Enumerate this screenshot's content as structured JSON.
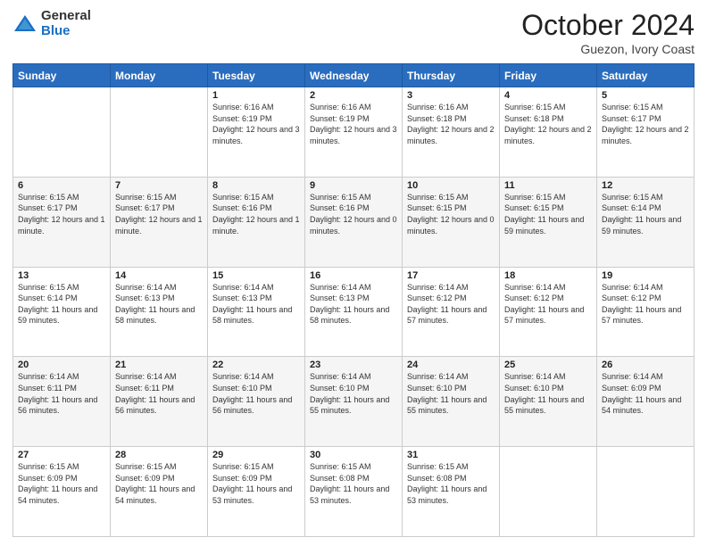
{
  "header": {
    "logo": {
      "general": "General",
      "blue": "Blue"
    },
    "title": "October 2024",
    "subtitle": "Guezon, Ivory Coast"
  },
  "weekdays": [
    "Sunday",
    "Monday",
    "Tuesday",
    "Wednesday",
    "Thursday",
    "Friday",
    "Saturday"
  ],
  "weeks": [
    [
      {
        "day": "",
        "info": ""
      },
      {
        "day": "",
        "info": ""
      },
      {
        "day": "1",
        "info": "Sunrise: 6:16 AM\nSunset: 6:19 PM\nDaylight: 12 hours and 3 minutes."
      },
      {
        "day": "2",
        "info": "Sunrise: 6:16 AM\nSunset: 6:19 PM\nDaylight: 12 hours and 3 minutes."
      },
      {
        "day": "3",
        "info": "Sunrise: 6:16 AM\nSunset: 6:18 PM\nDaylight: 12 hours and 2 minutes."
      },
      {
        "day": "4",
        "info": "Sunrise: 6:15 AM\nSunset: 6:18 PM\nDaylight: 12 hours and 2 minutes."
      },
      {
        "day": "5",
        "info": "Sunrise: 6:15 AM\nSunset: 6:17 PM\nDaylight: 12 hours and 2 minutes."
      }
    ],
    [
      {
        "day": "6",
        "info": "Sunrise: 6:15 AM\nSunset: 6:17 PM\nDaylight: 12 hours and 1 minute."
      },
      {
        "day": "7",
        "info": "Sunrise: 6:15 AM\nSunset: 6:17 PM\nDaylight: 12 hours and 1 minute."
      },
      {
        "day": "8",
        "info": "Sunrise: 6:15 AM\nSunset: 6:16 PM\nDaylight: 12 hours and 1 minute."
      },
      {
        "day": "9",
        "info": "Sunrise: 6:15 AM\nSunset: 6:16 PM\nDaylight: 12 hours and 0 minutes."
      },
      {
        "day": "10",
        "info": "Sunrise: 6:15 AM\nSunset: 6:15 PM\nDaylight: 12 hours and 0 minutes."
      },
      {
        "day": "11",
        "info": "Sunrise: 6:15 AM\nSunset: 6:15 PM\nDaylight: 11 hours and 59 minutes."
      },
      {
        "day": "12",
        "info": "Sunrise: 6:15 AM\nSunset: 6:14 PM\nDaylight: 11 hours and 59 minutes."
      }
    ],
    [
      {
        "day": "13",
        "info": "Sunrise: 6:15 AM\nSunset: 6:14 PM\nDaylight: 11 hours and 59 minutes."
      },
      {
        "day": "14",
        "info": "Sunrise: 6:14 AM\nSunset: 6:13 PM\nDaylight: 11 hours and 58 minutes."
      },
      {
        "day": "15",
        "info": "Sunrise: 6:14 AM\nSunset: 6:13 PM\nDaylight: 11 hours and 58 minutes."
      },
      {
        "day": "16",
        "info": "Sunrise: 6:14 AM\nSunset: 6:13 PM\nDaylight: 11 hours and 58 minutes."
      },
      {
        "day": "17",
        "info": "Sunrise: 6:14 AM\nSunset: 6:12 PM\nDaylight: 11 hours and 57 minutes."
      },
      {
        "day": "18",
        "info": "Sunrise: 6:14 AM\nSunset: 6:12 PM\nDaylight: 11 hours and 57 minutes."
      },
      {
        "day": "19",
        "info": "Sunrise: 6:14 AM\nSunset: 6:12 PM\nDaylight: 11 hours and 57 minutes."
      }
    ],
    [
      {
        "day": "20",
        "info": "Sunrise: 6:14 AM\nSunset: 6:11 PM\nDaylight: 11 hours and 56 minutes."
      },
      {
        "day": "21",
        "info": "Sunrise: 6:14 AM\nSunset: 6:11 PM\nDaylight: 11 hours and 56 minutes."
      },
      {
        "day": "22",
        "info": "Sunrise: 6:14 AM\nSunset: 6:10 PM\nDaylight: 11 hours and 56 minutes."
      },
      {
        "day": "23",
        "info": "Sunrise: 6:14 AM\nSunset: 6:10 PM\nDaylight: 11 hours and 55 minutes."
      },
      {
        "day": "24",
        "info": "Sunrise: 6:14 AM\nSunset: 6:10 PM\nDaylight: 11 hours and 55 minutes."
      },
      {
        "day": "25",
        "info": "Sunrise: 6:14 AM\nSunset: 6:10 PM\nDaylight: 11 hours and 55 minutes."
      },
      {
        "day": "26",
        "info": "Sunrise: 6:14 AM\nSunset: 6:09 PM\nDaylight: 11 hours and 54 minutes."
      }
    ],
    [
      {
        "day": "27",
        "info": "Sunrise: 6:15 AM\nSunset: 6:09 PM\nDaylight: 11 hours and 54 minutes."
      },
      {
        "day": "28",
        "info": "Sunrise: 6:15 AM\nSunset: 6:09 PM\nDaylight: 11 hours and 54 minutes."
      },
      {
        "day": "29",
        "info": "Sunrise: 6:15 AM\nSunset: 6:09 PM\nDaylight: 11 hours and 53 minutes."
      },
      {
        "day": "30",
        "info": "Sunrise: 6:15 AM\nSunset: 6:08 PM\nDaylight: 11 hours and 53 minutes."
      },
      {
        "day": "31",
        "info": "Sunrise: 6:15 AM\nSunset: 6:08 PM\nDaylight: 11 hours and 53 minutes."
      },
      {
        "day": "",
        "info": ""
      },
      {
        "day": "",
        "info": ""
      }
    ]
  ]
}
